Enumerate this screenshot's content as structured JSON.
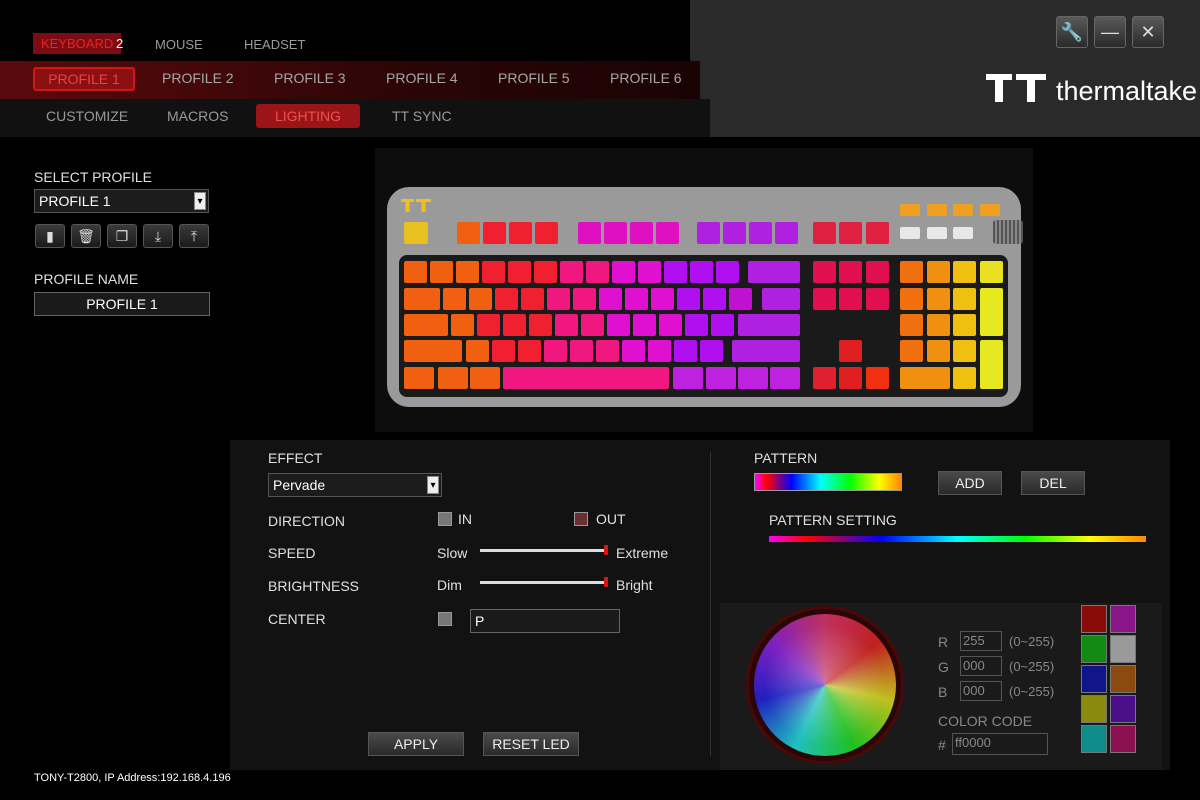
{
  "topnav": {
    "keyboard": "KEYBOARD",
    "keyboard_badge": "2",
    "mouse": "MOUSE",
    "headset": "HEADSET"
  },
  "profiles": [
    "PROFILE 1",
    "PROFILE 2",
    "PROFILE 3",
    "PROFILE 4",
    "PROFILE 5",
    "PROFILE 6"
  ],
  "subtabs": {
    "customize": "CUSTOMIZE",
    "macros": "MACROS",
    "lighting": "LIGHTING",
    "ttsync": "TT SYNC"
  },
  "brand": {
    "name": "thermaltake"
  },
  "window": {
    "settings_icon": "wrench-icon",
    "minimize": "—",
    "close": "✕"
  },
  "left": {
    "select_profile_label": "SELECT PROFILE",
    "select_profile_value": "PROFILE 1",
    "profile_name_label": "PROFILE NAME",
    "profile_name_value": "PROFILE 1",
    "icons": [
      "save-icon",
      "delete-icon",
      "copy-icon",
      "import-icon",
      "export-icon"
    ]
  },
  "effect": {
    "label": "EFFECT",
    "value": "Pervade",
    "direction_label": "DIRECTION",
    "in_label": "IN",
    "out_label": "OUT",
    "speed_label": "SPEED",
    "speed_min": "Slow",
    "speed_max": "Extreme",
    "speed_level": 1.0,
    "brightness_label": "BRIGHTNESS",
    "brightness_min": "Dim",
    "brightness_max": "Bright",
    "brightness_level": 1.0,
    "center_label": "CENTER",
    "center_value": "P",
    "apply": "APPLY",
    "reset": "RESET LED"
  },
  "pattern": {
    "label": "PATTERN",
    "add": "ADD",
    "del": "DEL",
    "setting_label": "PATTERN SETTING"
  },
  "color": {
    "r_label": "R",
    "r_value": "255",
    "r_range": "(0~255)",
    "g_label": "G",
    "g_value": "000",
    "g_range": "(0~255)",
    "b_label": "B",
    "b_value": "000",
    "b_range": "(0~255)",
    "code_label": "COLOR CODE",
    "hash": "#",
    "code_value": "ff0000",
    "swatches": [
      "#8b0a0a",
      "#8a148a",
      "#138a13",
      "#9a9a9a",
      "#10168a",
      "#8a4a10",
      "#8a8a10",
      "#4a108a",
      "#108a8a",
      "#8a1050"
    ]
  },
  "status": {
    "text": "TONY-T2800, IP Address:192.168.4.196"
  }
}
